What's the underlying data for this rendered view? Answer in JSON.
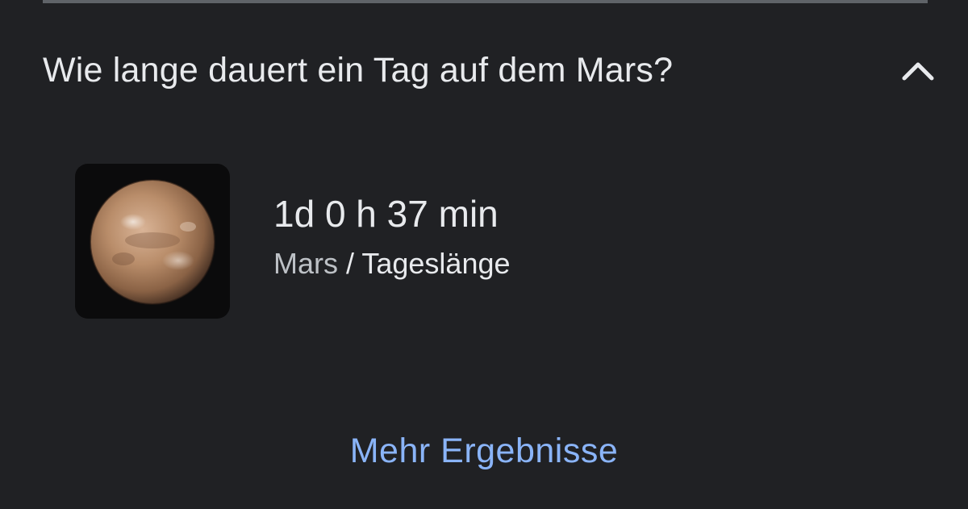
{
  "faq": {
    "question": "Wie lange dauert ein Tag auf dem Mars?",
    "expanded": true,
    "toggle_icon": "chevron-up-icon"
  },
  "answer": {
    "image_icon": "mars-planet-image",
    "value": "1d 0 h 37 min",
    "source_entity": "Mars",
    "source_separator": " / ",
    "source_attribute": "Tageslänge"
  },
  "more_results": {
    "label": "Mehr Ergebnisse"
  },
  "colors": {
    "background": "#202124",
    "text_primary": "#e8eaed",
    "text_secondary": "#bdc1c6",
    "link": "#8ab4f8",
    "divider": "#5f6368"
  }
}
